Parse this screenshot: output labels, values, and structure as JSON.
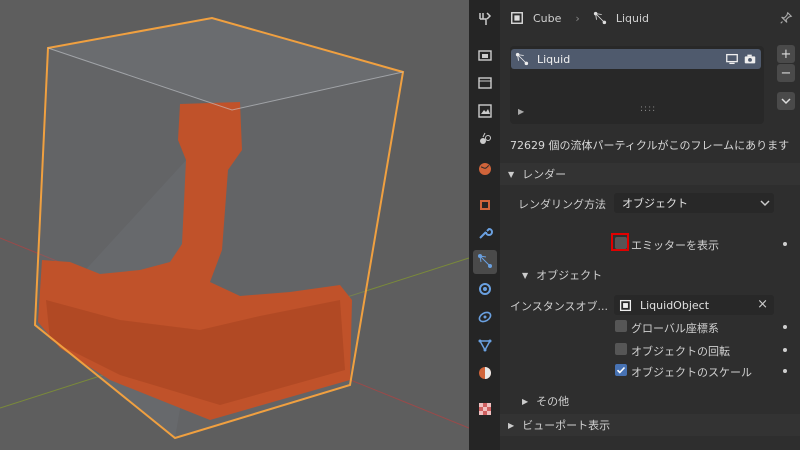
{
  "breadcrumb": {
    "object": "Cube",
    "modifier": "Liquid"
  },
  "particle_list": {
    "items": [
      {
        "label": "Liquid"
      }
    ]
  },
  "info_text": "72629 個の流体パーティクルがこのフレームにあります",
  "render_section": {
    "title": "レンダー",
    "render_as_label": "レンダリング方法",
    "render_as_value": "オブジェクト",
    "show_emitter_label": "エミッターを表示",
    "show_emitter_checked": false
  },
  "object_section": {
    "title": "オブジェクト",
    "instance_label": "インスタンスオブ...",
    "instance_value": "LiquidObject",
    "global_coords_label": "グローバル座標系",
    "global_coords_checked": false,
    "object_rotation_label": "オブジェクトの回転",
    "object_rotation_checked": false,
    "object_scale_label": "オブジェクトのスケール",
    "object_scale_checked": true
  },
  "other_section": {
    "title": "その他"
  },
  "viewport_display_section": {
    "title": "ビューポート表示"
  },
  "colors": {
    "viewport_bg": "#5e5e5e",
    "selection_outline": "#f0a040",
    "liquid": "#c0522a",
    "highlight_box": "#e00000",
    "checkbox_on": "#4772b3",
    "list_selected": "#4f5a6d"
  },
  "tab_icons": [
    "tool-icon",
    "render-icon",
    "output-icon",
    "view-layer-icon",
    "scene-icon",
    "world-icon",
    "object-icon",
    "modifier-icon",
    "particles-icon",
    "physics-icon",
    "constraints-icon",
    "object-data-icon",
    "material-icon",
    "texture-icon"
  ]
}
